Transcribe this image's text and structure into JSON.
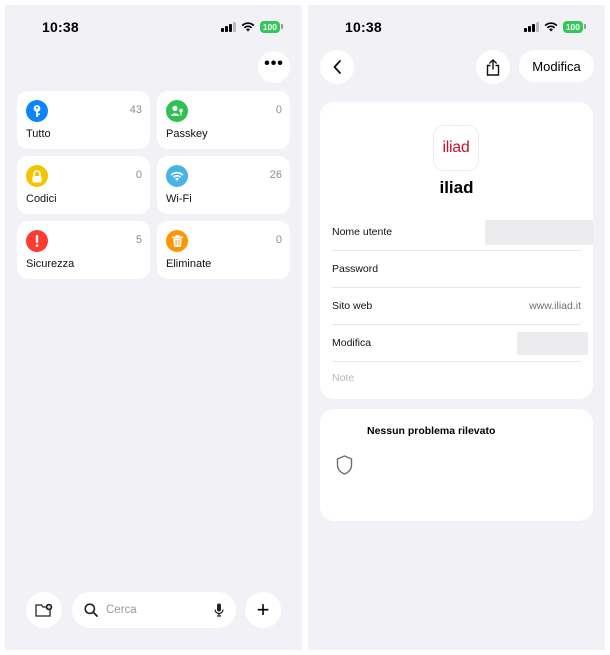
{
  "left_screen": {
    "status": {
      "time": "10:38",
      "battery": "100"
    },
    "more_label": "•••",
    "tiles": [
      {
        "label": "Tutto",
        "count": "43",
        "color": "#0a84ff",
        "icon": "key-icon"
      },
      {
        "label": "Passkey",
        "count": "0",
        "color": "#30c152",
        "icon": "person-key-icon"
      },
      {
        "label": "Codici",
        "count": "0",
        "color": "#f5c400",
        "icon": "lock-icon"
      },
      {
        "label": "Wi-Fi",
        "count": "26",
        "color": "#4ab3e5",
        "icon": "wifi-icon"
      },
      {
        "label": "Sicurezza",
        "count": "5",
        "color": "#ff3b30",
        "icon": "exclamation-icon"
      },
      {
        "label": "Eliminate",
        "count": "0",
        "color": "#ff9500",
        "icon": "trash-icon"
      }
    ],
    "search": {
      "placeholder": "Cerca"
    },
    "add_label": "+"
  },
  "right_screen": {
    "status": {
      "time": "10:38",
      "battery": "100"
    },
    "edit_label": "Modifica",
    "app": {
      "logo_text": "iliad",
      "name": "iliad",
      "logo_color": "#c8102e"
    },
    "fields": [
      {
        "label": "Nome utente",
        "value": ""
      },
      {
        "label": "Password",
        "value": ""
      },
      {
        "label": "Sito web",
        "value": "www.iliad.it"
      },
      {
        "label": "Modifica",
        "value": ""
      }
    ],
    "notes_placeholder": "Note",
    "security": {
      "title": "Nessun problema rilevato"
    }
  }
}
